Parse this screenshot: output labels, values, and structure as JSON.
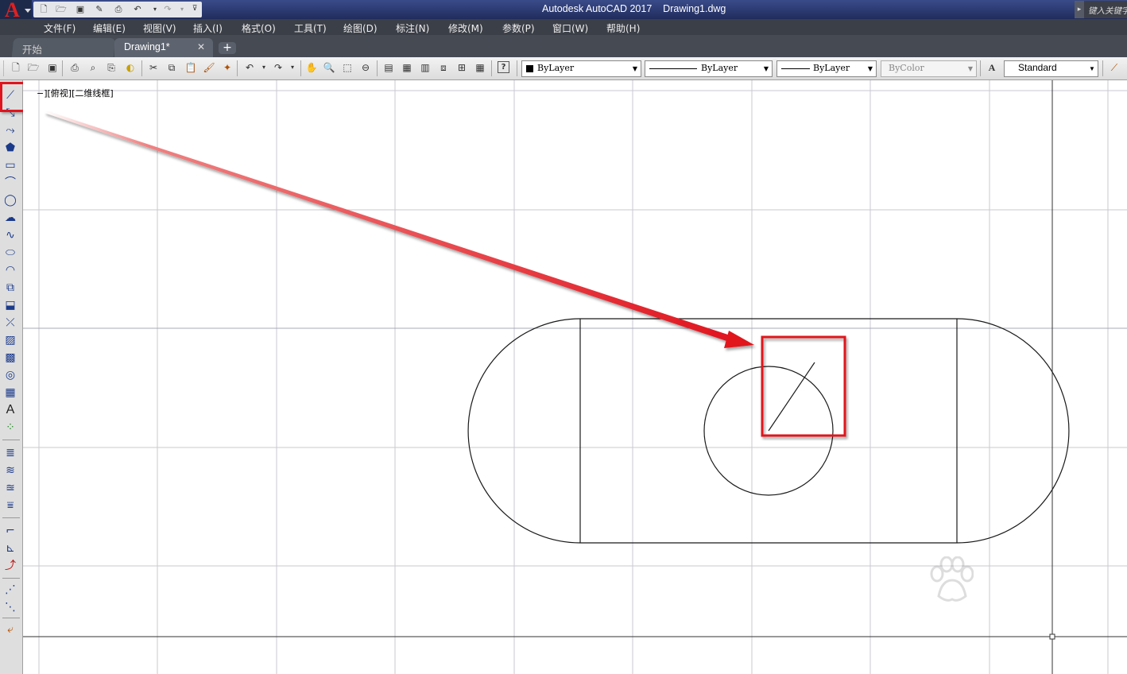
{
  "app": {
    "title": "Autodesk AutoCAD 2017    Drawing1.dwg",
    "logo_letter": "A",
    "search_placeholder": "键入关键字"
  },
  "menu": [
    "文件(F)",
    "编辑(E)",
    "视图(V)",
    "插入(I)",
    "格式(O)",
    "工具(T)",
    "绘图(D)",
    "标注(N)",
    "修改(M)",
    "参数(P)",
    "窗口(W)",
    "帮助(H)"
  ],
  "tabs": [
    {
      "label": "开始",
      "active": false
    },
    {
      "label": "Drawing1*",
      "active": true
    }
  ],
  "new_tab_label": "+",
  "properties": {
    "color": "ByLayer",
    "linetype": "ByLayer",
    "lineweight": "ByLayer",
    "plotstyle": "ByColor",
    "textstyle": "Standard"
  },
  "viewport": {
    "label_prefix": "[",
    "minus": "−",
    "label_view": "][俯视][",
    "label_style": "二维线框",
    "label_suffix": "]"
  },
  "icons": {
    "standard_toolbar": [
      "new-icon",
      "open-icon",
      "save-icon",
      "print-icon",
      "plot-preview-icon",
      "publish-icon",
      "render-icon",
      "cut-icon",
      "copy-icon",
      "paste-icon",
      "match-properties-icon",
      "block-editor-icon",
      "undo-icon",
      "redo-icon",
      "pan-icon",
      "zoom-realtime-icon",
      "zoom-window-icon",
      "zoom-previous-icon",
      "properties-icon",
      "design-center-icon",
      "tool-palettes-icon",
      "sheet-set-icon",
      "markup-icon",
      "calculator-icon",
      "help-icon"
    ],
    "draw_toolbar": [
      "line-icon",
      "construction-line-icon",
      "polyline-icon",
      "polygon-icon",
      "rectangle-icon",
      "arc-icon",
      "circle-icon",
      "revision-cloud-icon",
      "spline-icon",
      "ellipse-icon",
      "ellipse-arc-icon",
      "insert-block-icon",
      "make-block-icon",
      "point-icon",
      "hatch-icon",
      "gradient-icon",
      "region-icon",
      "table-icon",
      "multiline-text-icon",
      "add-selected-icon"
    ]
  },
  "colors": {
    "highlight": "#e0141e",
    "title_bar": "#2a3670",
    "menu_bar": "#3b3f47",
    "tab_bar": "#454a53",
    "grid_line": "#c8c8d0",
    "geometry": "#1a1a1a"
  }
}
